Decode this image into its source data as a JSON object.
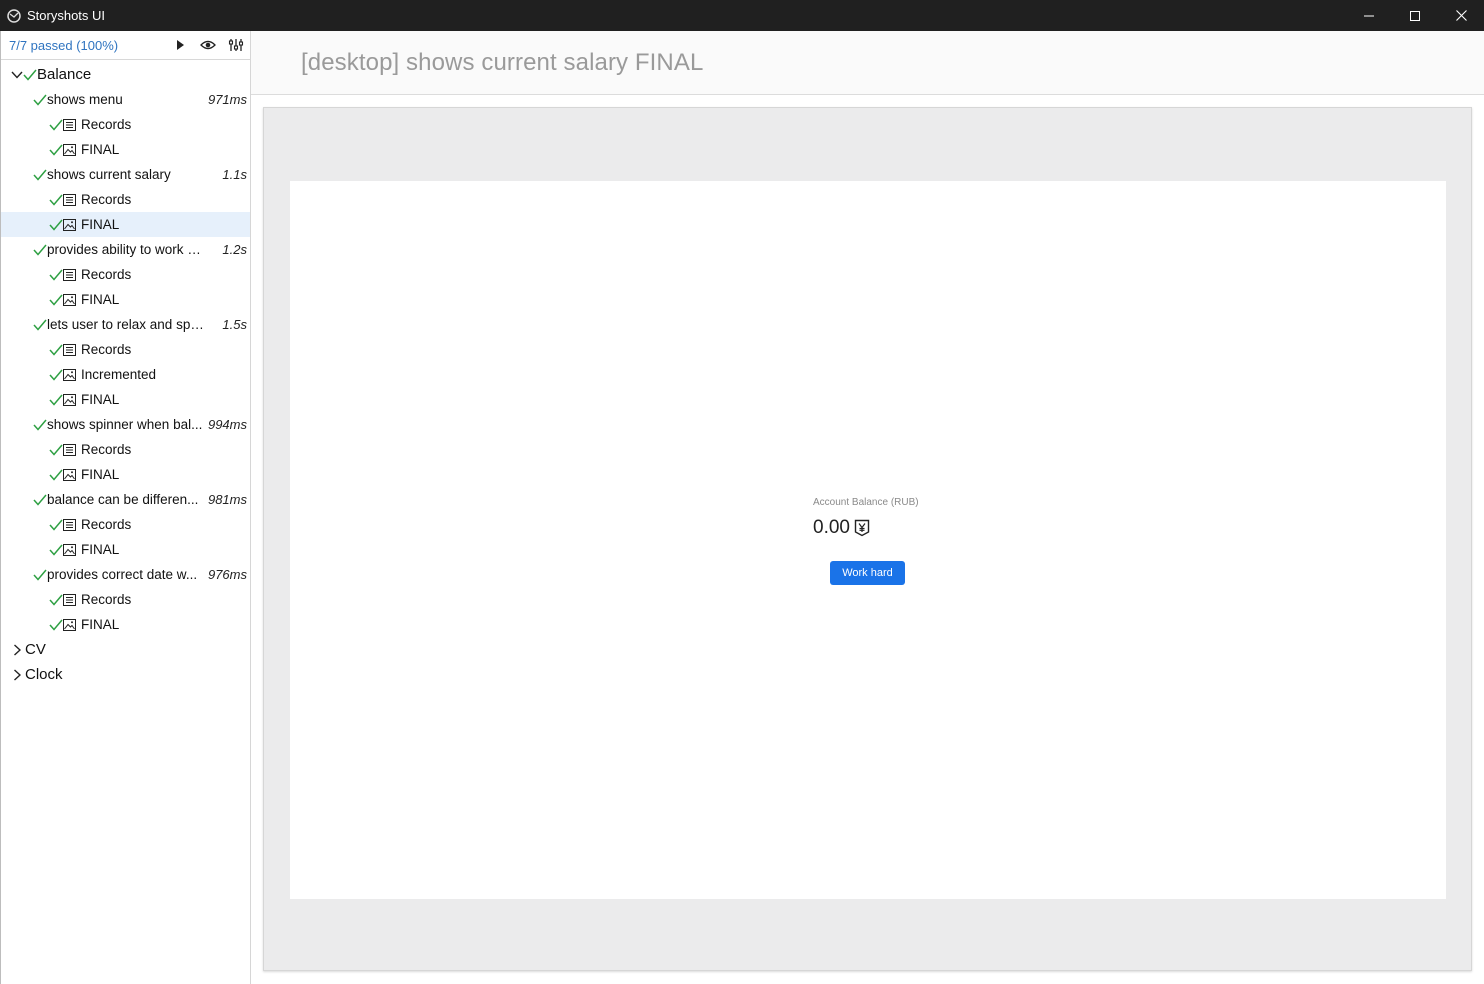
{
  "window": {
    "title": "Storyshots UI"
  },
  "toolbar": {
    "summary": "7/7 passed (100%)"
  },
  "tree": {
    "groups": [
      {
        "name": "Balance",
        "expanded": true,
        "stories": [
          {
            "name": "shows menu",
            "duration": "971ms",
            "children": [
              "Records",
              "FINAL"
            ]
          },
          {
            "name": "shows current salary",
            "duration": "1.1s",
            "children": [
              "Records",
              "FINAL"
            ]
          },
          {
            "name": "provides ability to work ha...",
            "duration": "1.2s",
            "children": [
              "Records",
              "FINAL"
            ]
          },
          {
            "name": "lets user to relax and spen...",
            "duration": "1.5s",
            "children": [
              "Records",
              "Incremented",
              "FINAL"
            ]
          },
          {
            "name": "shows spinner when bal...",
            "duration": "994ms",
            "children": [
              "Records",
              "FINAL"
            ]
          },
          {
            "name": "balance can be differen...",
            "duration": "981ms",
            "children": [
              "Records",
              "FINAL"
            ]
          },
          {
            "name": "provides correct date w...",
            "duration": "976ms",
            "children": [
              "Records",
              "FINAL"
            ]
          }
        ]
      },
      {
        "name": "CV",
        "expanded": false
      },
      {
        "name": "Clock",
        "expanded": false
      }
    ]
  },
  "main": {
    "title": "[desktop] shows current salary FINAL",
    "preview": {
      "balance_label": "Account Balance (RUB)",
      "balance_value": "0.00",
      "button_label": "Work hard"
    }
  },
  "colors": {
    "accent": "#1a73e8",
    "check": "#2ea043",
    "link": "#2f74c0",
    "selected": "#e6f0fb",
    "titlebar": "#202020"
  }
}
